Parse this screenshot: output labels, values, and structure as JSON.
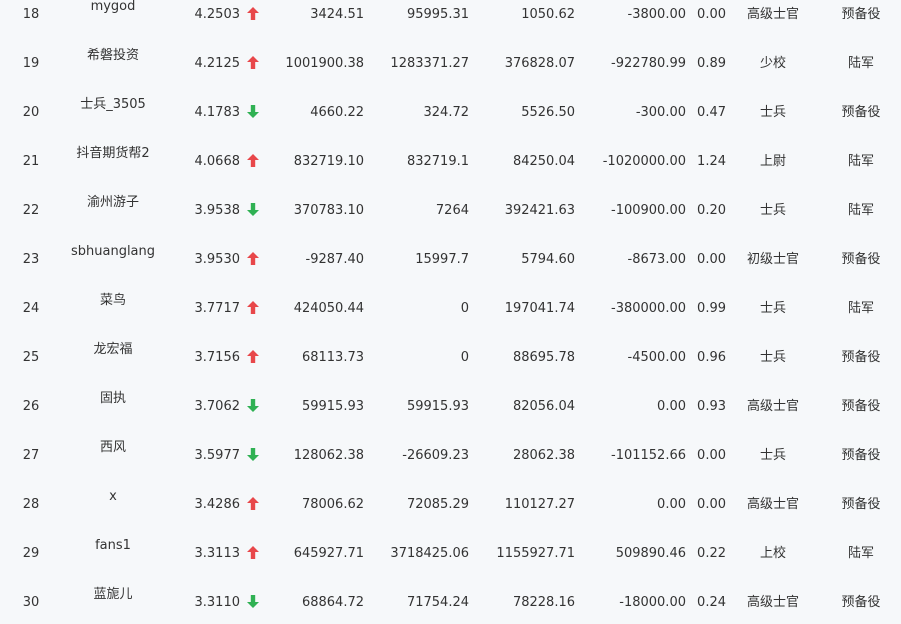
{
  "colors": {
    "up": "#e8474a",
    "down": "#2fb153",
    "text": "#333333",
    "background": "#f6f8fa"
  },
  "rows": [
    {
      "rank": "18",
      "name": "mygod",
      "score": "4.2503",
      "trend": "up",
      "v1": "3424.51",
      "v2": "95995.31",
      "v3": "1050.62",
      "v4": "-3800.00",
      "v5": "0.00",
      "military_rank": "高级士官",
      "branch": "预备役"
    },
    {
      "rank": "19",
      "name": "希磐投资",
      "score": "4.2125",
      "trend": "up",
      "v1": "1001900.38",
      "v2": "1283371.27",
      "v3": "376828.07",
      "v4": "-922780.99",
      "v5": "0.89",
      "military_rank": "少校",
      "branch": "陆军"
    },
    {
      "rank": "20",
      "name": "士兵_3505",
      "score": "4.1783",
      "trend": "down",
      "v1": "4660.22",
      "v2": "324.72",
      "v3": "5526.50",
      "v4": "-300.00",
      "v5": "0.47",
      "military_rank": "士兵",
      "branch": "预备役"
    },
    {
      "rank": "21",
      "name": "抖音期货帮2",
      "score": "4.0668",
      "trend": "up",
      "v1": "832719.10",
      "v2": "832719.1",
      "v3": "84250.04",
      "v4": "-1020000.00",
      "v5": "1.24",
      "military_rank": "上尉",
      "branch": "陆军"
    },
    {
      "rank": "22",
      "name": "渝州游子",
      "score": "3.9538",
      "trend": "down",
      "v1": "370783.10",
      "v2": "7264",
      "v3": "392421.63",
      "v4": "-100900.00",
      "v5": "0.20",
      "military_rank": "士兵",
      "branch": "陆军"
    },
    {
      "rank": "23",
      "name": "sbhuanglang",
      "score": "3.9530",
      "trend": "up",
      "v1": "-9287.40",
      "v2": "15997.7",
      "v3": "5794.60",
      "v4": "-8673.00",
      "v5": "0.00",
      "military_rank": "初级士官",
      "branch": "预备役"
    },
    {
      "rank": "24",
      "name": "菜鸟",
      "score": "3.7717",
      "trend": "up",
      "v1": "424050.44",
      "v2": "0",
      "v3": "197041.74",
      "v4": "-380000.00",
      "v5": "0.99",
      "military_rank": "士兵",
      "branch": "陆军"
    },
    {
      "rank": "25",
      "name": "龙宏福",
      "score": "3.7156",
      "trend": "up",
      "v1": "68113.73",
      "v2": "0",
      "v3": "88695.78",
      "v4": "-4500.00",
      "v5": "0.96",
      "military_rank": "士兵",
      "branch": "预备役"
    },
    {
      "rank": "26",
      "name": "固执",
      "score": "3.7062",
      "trend": "down",
      "v1": "59915.93",
      "v2": "59915.93",
      "v3": "82056.04",
      "v4": "0.00",
      "v5": "0.93",
      "military_rank": "高级士官",
      "branch": "预备役"
    },
    {
      "rank": "27",
      "name": "西风",
      "score": "3.5977",
      "trend": "down",
      "v1": "128062.38",
      "v2": "-26609.23",
      "v3": "28062.38",
      "v4": "-101152.66",
      "v5": "0.00",
      "military_rank": "士兵",
      "branch": "预备役"
    },
    {
      "rank": "28",
      "name": "x",
      "score": "3.4286",
      "trend": "up",
      "v1": "78006.62",
      "v2": "72085.29",
      "v3": "110127.27",
      "v4": "0.00",
      "v5": "0.00",
      "military_rank": "高级士官",
      "branch": "预备役"
    },
    {
      "rank": "29",
      "name": "fans1",
      "score": "3.3113",
      "trend": "up",
      "v1": "645927.71",
      "v2": "3718425.06",
      "v3": "1155927.71",
      "v4": "509890.46",
      "v5": "0.22",
      "military_rank": "上校",
      "branch": "陆军"
    },
    {
      "rank": "30",
      "name": "蓝旎儿",
      "score": "3.3110",
      "trend": "down",
      "v1": "68864.72",
      "v2": "71754.24",
      "v3": "78228.16",
      "v4": "-18000.00",
      "v5": "0.24",
      "military_rank": "高级士官",
      "branch": "预备役"
    }
  ]
}
